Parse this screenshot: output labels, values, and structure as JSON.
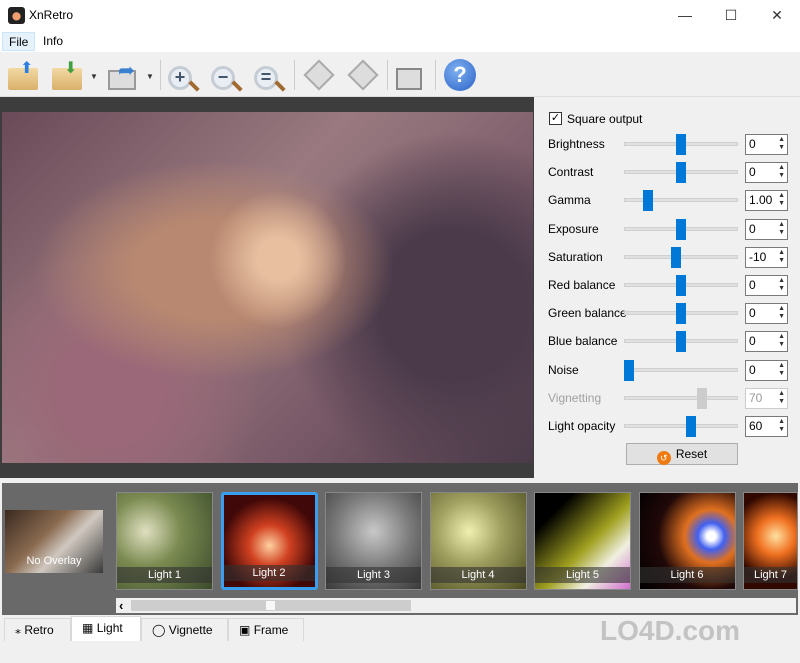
{
  "window": {
    "title": "XnRetro",
    "minimize": "—",
    "maximize": "☐",
    "close": "✕"
  },
  "menu": [
    {
      "label": "File"
    },
    {
      "label": "Info"
    }
  ],
  "toolbar": {
    "items": [
      "open-icon",
      "save-icon",
      "export-icon",
      "zoom-in-icon",
      "zoom-out-icon",
      "zoom-fit-icon",
      "rotate-left-icon",
      "rotate-right-icon",
      "wallpaper-icon",
      "help-icon"
    ],
    "help_glyph": "?",
    "zoom_in": "+",
    "zoom_out": "−",
    "zoom_fit": "="
  },
  "panel": {
    "square_output": {
      "label": "Square output",
      "checked": true,
      "check": "✓"
    },
    "sliders": [
      {
        "label": "Brightness",
        "value": "0",
        "position": 0.5,
        "enabled": true
      },
      {
        "label": "Contrast",
        "value": "0",
        "position": 0.5,
        "enabled": true
      },
      {
        "label": "Gamma",
        "value": "1.00",
        "position": 0.18,
        "enabled": true
      },
      {
        "label": "Exposure",
        "value": "0",
        "position": 0.5,
        "enabled": true
      },
      {
        "label": "Saturation",
        "value": "-10",
        "position": 0.45,
        "enabled": true
      },
      {
        "label": "Red balance",
        "value": "0",
        "position": 0.5,
        "enabled": true
      },
      {
        "label": "Green balance",
        "value": "0",
        "position": 0.5,
        "enabled": true
      },
      {
        "label": "Blue balance",
        "value": "0",
        "position": 0.5,
        "enabled": true
      },
      {
        "label": "Noise",
        "value": "0",
        "position": 0.0,
        "enabled": true
      },
      {
        "label": "Vignetting",
        "value": "70",
        "position": 0.7,
        "enabled": false
      },
      {
        "label": "Light opacity",
        "value": "60",
        "position": 0.6,
        "enabled": true
      }
    ],
    "reset_label": "Reset"
  },
  "overlays": {
    "none_label": "No Overlay",
    "items": [
      {
        "label": "Light 1",
        "bg": "radial-gradient(circle at 30% 40%,#e0e0c0,#7a8a50 40%,#3a4a2a)"
      },
      {
        "label": "Light 2",
        "bg": "radial-gradient(circle at 50% 55%,#ffd0a0,#d04020 30%,#400808 70%)",
        "selected": true
      },
      {
        "label": "Light 3",
        "bg": "radial-gradient(circle at 50% 40%,#c8c8c8,#7a7a7a 50%,#3a3a3a)"
      },
      {
        "label": "Light 4",
        "bg": "radial-gradient(circle at 40% 40%,#f0f0b0,#a0a060 40%,#4a4a20)"
      },
      {
        "label": "Light 5",
        "bg": "linear-gradient(135deg,#000 20%,#a0a020 55%,#f0f0e0 75%,#d070d0)"
      },
      {
        "label": "Light 6",
        "bg": "radial-gradient(circle at 75% 45%,#fff 0 5%,#4060f0 15%,#e07020 30%,#200808 60%,#000)"
      },
      {
        "label": "Light 7",
        "bg": "radial-gradient(circle at 60% 45%,#ffe0a0,#f07020 30%,#300800 70%)"
      }
    ]
  },
  "tabs": [
    {
      "label": "Retro",
      "icon": "magic-wand-icon",
      "glyph": "⁎"
    },
    {
      "label": "Light",
      "icon": "light-icon",
      "glyph": "▦",
      "active": true
    },
    {
      "label": "Vignette",
      "icon": "vignette-icon",
      "glyph": "◯"
    },
    {
      "label": "Frame",
      "icon": "frame-icon",
      "glyph": "▣"
    }
  ],
  "scroll": {
    "left": "‹",
    "position": 0.22
  },
  "watermark": "LO4D.com"
}
